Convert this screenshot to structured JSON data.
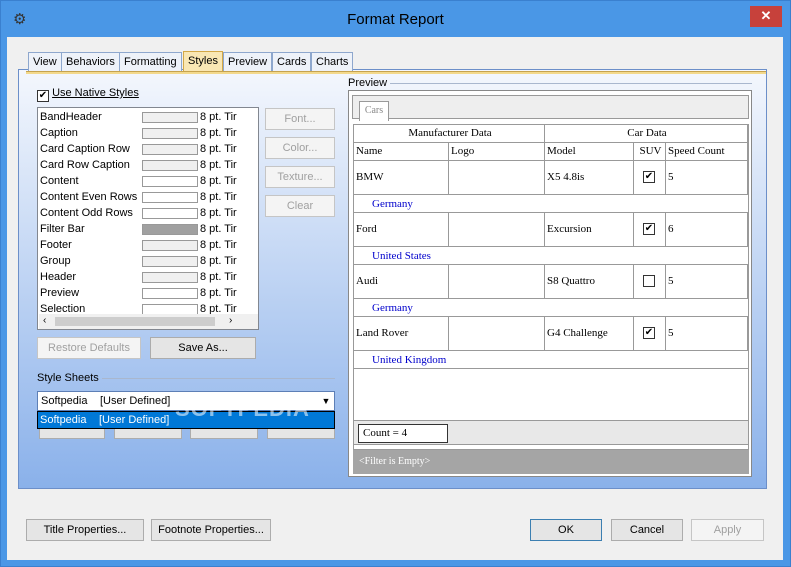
{
  "window": {
    "title": "Format Report",
    "close_glyph": "✕"
  },
  "tabs": [
    "View",
    "Behaviors",
    "Formatting",
    "Styles",
    "Preview",
    "Cards",
    "Charts"
  ],
  "active_tab": "Styles",
  "use_native_styles": {
    "label": "Use Native Styles",
    "checked": true
  },
  "styles_list": [
    {
      "name": "BandHeader",
      "font": "8 pt. Tir",
      "swatch": "#f0f0f0"
    },
    {
      "name": "Caption",
      "font": "8 pt. Tir",
      "swatch": "#f0f0f0"
    },
    {
      "name": "Card Caption Row",
      "font": "8 pt. Tir",
      "swatch": "#f0f0f0"
    },
    {
      "name": "Card Row Caption",
      "font": "8 pt. Tir",
      "swatch": "#f0f0f0"
    },
    {
      "name": "Content",
      "font": "8 pt. Tir",
      "swatch": "#ffffff"
    },
    {
      "name": "Content Even Rows",
      "font": "8 pt. Tir",
      "swatch": "#ffffff"
    },
    {
      "name": "Content Odd Rows",
      "font": "8 pt. Tir",
      "swatch": "#ffffff"
    },
    {
      "name": "Filter Bar",
      "font": "8 pt. Tir",
      "swatch": "#a0a0a0"
    },
    {
      "name": "Footer",
      "font": "8 pt. Tir",
      "swatch": "#f0f0f0"
    },
    {
      "name": "Group",
      "font": "8 pt. Tir",
      "swatch": "#f0f0f0"
    },
    {
      "name": "Header",
      "font": "8 pt. Tir",
      "swatch": "#f0f0f0"
    },
    {
      "name": "Preview",
      "font": "8 pt. Tir",
      "swatch": "#ffffff"
    },
    {
      "name": "Selection",
      "font": "8 pt. Tir",
      "swatch": "#ffffff"
    }
  ],
  "style_buttons": {
    "font": "Font...",
    "color": "Color...",
    "texture": "Texture...",
    "clear": "Clear"
  },
  "restore_defaults": "Restore Defaults",
  "save_as": "Save As...",
  "style_sheets": {
    "label": "Style Sheets",
    "selected_name": "Softpedia",
    "selected_type": "[User Defined]",
    "dropdown_item_name": "Softpedia",
    "dropdown_item_type": "[User Defined]",
    "arrow": "▼"
  },
  "preview": {
    "label": "Preview",
    "tab": "Cars",
    "band_headers": [
      "Manufacturer Data",
      "Car Data"
    ],
    "columns": [
      "Name",
      "Logo",
      "Model",
      "SUV",
      "Speed Count"
    ],
    "rows": [
      {
        "name": "BMW",
        "model": "X5 4.8is",
        "suv": true,
        "speed": "5",
        "country": "Germany"
      },
      {
        "name": "Ford",
        "model": "Excursion",
        "suv": true,
        "speed": "6",
        "country": "United States"
      },
      {
        "name": "Audi",
        "model": "S8 Quattro",
        "suv": false,
        "speed": "5",
        "country": "Germany"
      },
      {
        "name": "Land Rover",
        "model": "G4 Challenge",
        "suv": true,
        "speed": "5",
        "country": "United Kingdom"
      }
    ],
    "count": "Count = 4",
    "filter": "<Filter is Empty>"
  },
  "watermark": "SOFTPEDIA",
  "bottom_buttons": {
    "title_properties": "Title Properties...",
    "footnote_properties": "Footnote Properties...",
    "ok": "OK",
    "cancel": "Cancel",
    "apply": "Apply"
  }
}
